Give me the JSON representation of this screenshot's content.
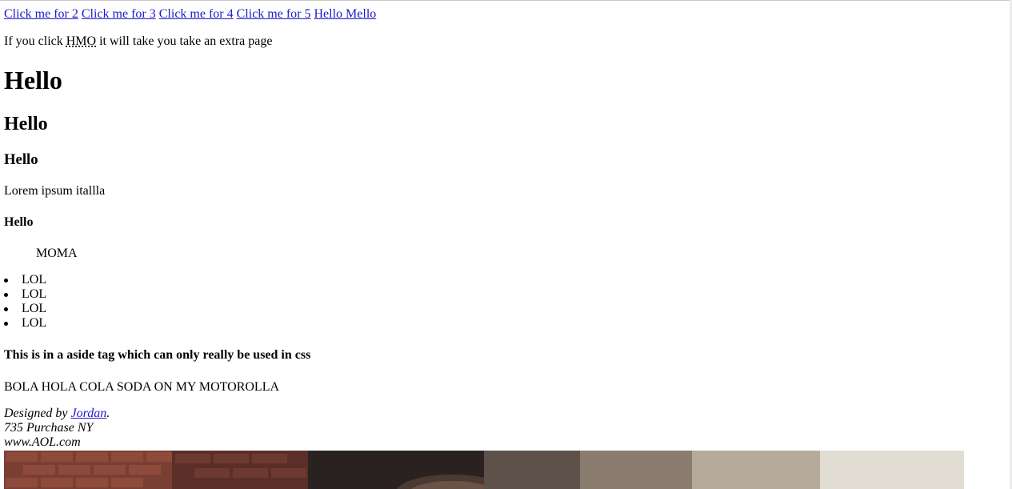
{
  "nav": {
    "links": [
      "Click me for 2",
      "Click me for 3",
      "Click me for 4",
      "Click me for 5",
      "Hello Mello"
    ]
  },
  "intro": {
    "before": "If you click ",
    "abbr": "HMO",
    "after": " it will take you take an extra page"
  },
  "headings": {
    "h1": "Hello",
    "h2": "Hello",
    "h3": "Hello",
    "h4": "Hello"
  },
  "para1": "Lorem ipsum itallla",
  "quote": "MOMA",
  "list": {
    "items": [
      "LOL",
      "LOL",
      "LOL",
      "LOL"
    ]
  },
  "aside": {
    "heading": "This is in a aside tag which can only really be used in css"
  },
  "para2": "BOLA HOLA COLA SODA ON MY MOTOROLLA",
  "footer": {
    "designed_prefix": "Designed by ",
    "designer_link": "Jordan",
    "designed_suffix": ".",
    "address": "735 Purchase NY",
    "website": "www.AOL.com"
  },
  "colors": {
    "link": "#1f18c8"
  }
}
